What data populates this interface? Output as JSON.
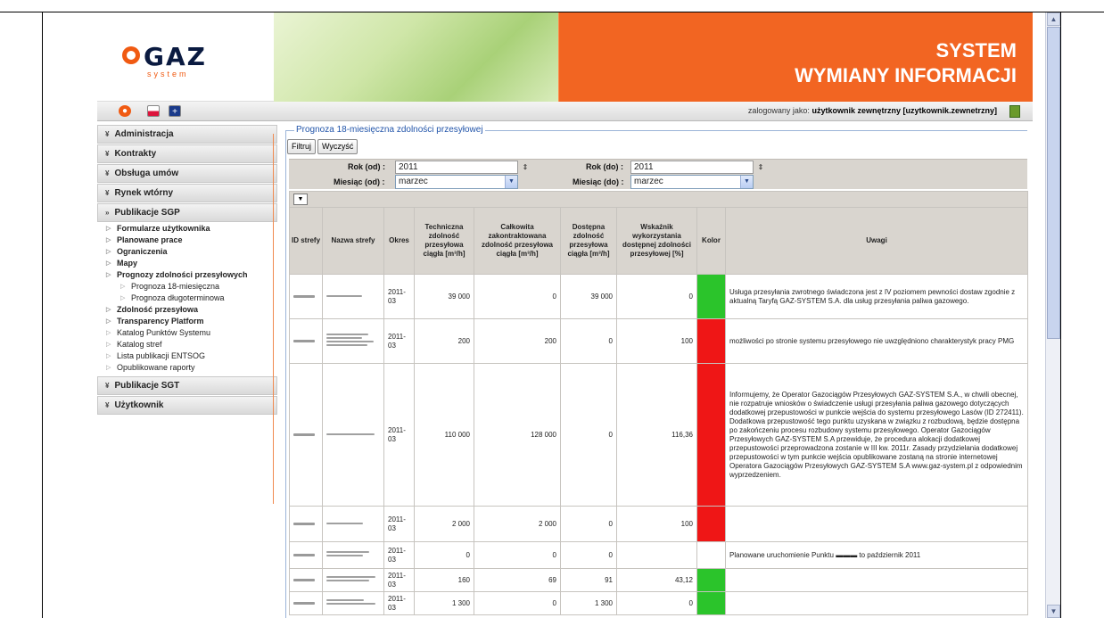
{
  "colors": {
    "orange": "#f26522",
    "green": "#2bc42b",
    "red": "#ef1616",
    "fieldset_blue": "#2255aa"
  },
  "header": {
    "logo_text": "GAZ",
    "logo_sub": "system",
    "title_line1": "SYSTEM",
    "title_line2": "WYMIANY INFORMACJI"
  },
  "toolbar": {
    "login_prefix": "zalogowany jako:",
    "login_user": "użytkownik zewnętrzny [uzytkownik.zewnetrzny]"
  },
  "sidebar": {
    "sections": [
      {
        "label": "Administracja",
        "icon": "chevron-double-down-icon"
      },
      {
        "label": "Kontrakty",
        "icon": "chevron-double-down-icon"
      },
      {
        "label": "Obsługa umów",
        "icon": "chevron-double-down-icon"
      },
      {
        "label": "Rynek wtórny",
        "icon": "chevron-double-down-icon"
      },
      {
        "label": "Publikacje SGP",
        "icon": "chevron-double-right-icon"
      }
    ],
    "sgp_items": [
      {
        "label": "Formularze użytkownika",
        "bold": true
      },
      {
        "label": "Planowane prace",
        "bold": true
      },
      {
        "label": "Ograniczenia",
        "bold": true
      },
      {
        "label": "Mapy",
        "bold": true
      },
      {
        "label": "Prognozy zdolności przesyłowych",
        "bold": true
      },
      {
        "label": "Prognoza 18-miesięczna",
        "bold": false,
        "level": 2
      },
      {
        "label": "Prognoza długoterminowa",
        "bold": false,
        "level": 2
      },
      {
        "label": "Zdolność przesyłowa",
        "bold": true
      },
      {
        "label": "Transparency Platform",
        "bold": true
      },
      {
        "label": "Katalog Punktów Systemu",
        "bold": false
      },
      {
        "label": "Katalog stref",
        "bold": false
      },
      {
        "label": "Lista publikacji ENTSOG",
        "bold": false
      },
      {
        "label": "Opublikowane raporty",
        "bold": false
      }
    ],
    "tail_sections": [
      {
        "label": "Publikacje SGT",
        "icon": "chevron-double-down-icon"
      },
      {
        "label": "Użytkownik",
        "icon": "chevron-double-down-icon"
      }
    ]
  },
  "content": {
    "legend": "Prognoza 18-miesięczna zdolności przesyłowej",
    "filter_button": "Filtruj",
    "clear_button": "Wyczyść",
    "filters": {
      "rok_od_label": "Rok (od) :",
      "rok_od_value": "2011",
      "rok_do_label": "Rok (do) :",
      "rok_do_value": "2011",
      "miesiac_od_label": "Miesiąc (od) :",
      "miesiac_od_value": "marzec",
      "miesiac_do_label": "Miesiąc (do) :",
      "miesiac_do_value": "marzec"
    },
    "columns": [
      "ID strefy",
      "Nazwa strefy",
      "Okres",
      "Techniczna zdolność przesyłowa ciągła [m³/h]",
      "Całkowita zakontraktowana zdolność przesyłowa ciągła [m³/h]",
      "Dostępna zdolność przesyłowa ciągła [m³/h]",
      "Wskaźnik wykorzystania dostępnej zdolności przesyłowej [%]",
      "Kolor",
      "Uwagi"
    ],
    "rows": [
      {
        "okres": "2011-03",
        "techniczna": "39 000",
        "zakontraktowana": "0",
        "dostepna": "39 000",
        "wskaznik": "0",
        "kolor": "green",
        "uwagi": "Usługa przesyłania zwrotnego świadczona jest z IV poziomem pewności dostaw zgodnie z aktualną Taryfą GAZ-SYSTEM S.A. dla usług przesyłania paliwa gazowego."
      },
      {
        "okres": "2011-03",
        "techniczna": "200",
        "zakontraktowana": "200",
        "dostepna": "0",
        "wskaznik": "100",
        "kolor": "red",
        "uwagi": "możliwości po stronie systemu przesyłowego nie uwzględniono charakterystyk pracy PMG"
      },
      {
        "okres": "2011-03",
        "techniczna": "110 000",
        "zakontraktowana": "128 000",
        "dostepna": "0",
        "wskaznik": "116,36",
        "kolor": "red",
        "uwagi": "Informujemy, że Operator Gazociągów Przesyłowych GAZ-SYSTEM S.A., w chwili obecnej, nie rozpatruje wniosków o świadczenie usługi przesyłania paliwa gazowego dotyczących dodatkowej przepustowości w punkcie wejścia do systemu przesyłowego Lasów (ID 272411). Dodatkowa przepustowość tego punktu uzyskana w związku z rozbudową, będzie dostępna po zakończeniu procesu rozbudowy systemu przesyłowego. Operator Gazociągów Przesyłowych GAZ-SYSTEM S.A przewiduje, że procedura alokacji dodatkowej przepustowości przeprowadzona zostanie w III kw. 2011r. Zasady przydzielania dodatkowej przepustowości w tym punkcie wejścia opublikowane zostaną na stronie internetowej Operatora Gazociągów Przesyłowych GAZ-SYSTEM S.A www.gaz-system.pl z odpowiednim wyprzedzeniem."
      },
      {
        "okres": "2011-03",
        "techniczna": "2 000",
        "zakontraktowana": "2 000",
        "dostepna": "0",
        "wskaznik": "100",
        "kolor": "red",
        "uwagi": ""
      },
      {
        "okres": "2011-03",
        "techniczna": "0",
        "zakontraktowana": "0",
        "dostepna": "0",
        "wskaznik": "",
        "kolor": "none",
        "uwagi": "Planowane uruchomienie Punktu ▬▬▬ to październik 2011"
      },
      {
        "okres": "2011-03",
        "techniczna": "160",
        "zakontraktowana": "69",
        "dostepna": "91",
        "wskaznik": "43,12",
        "kolor": "green",
        "uwagi": ""
      },
      {
        "okres": "2011-03",
        "techniczna": "1 300",
        "zakontraktowana": "0",
        "dostepna": "1 300",
        "wskaznik": "0",
        "kolor": "green",
        "uwagi": ""
      }
    ]
  }
}
